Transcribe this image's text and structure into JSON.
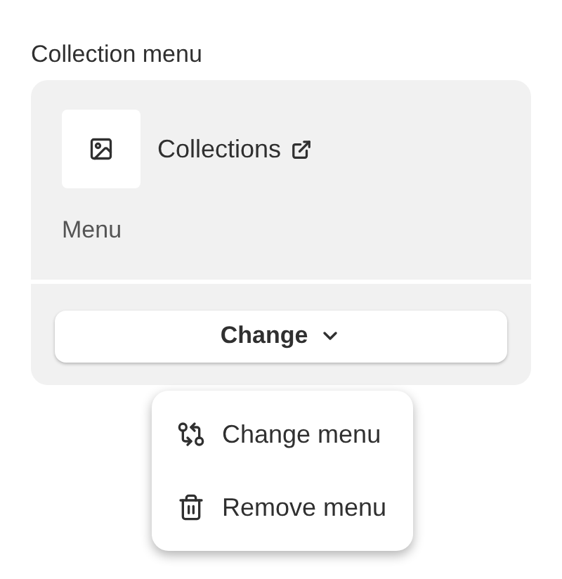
{
  "section_title": "Collection menu",
  "card": {
    "link": {
      "label": "Collections"
    },
    "subtitle": "Menu",
    "button": {
      "label": "Change"
    }
  },
  "dropdown": {
    "items": [
      {
        "kind": "change",
        "label": "Change menu"
      },
      {
        "kind": "remove",
        "label": "Remove menu"
      }
    ]
  }
}
